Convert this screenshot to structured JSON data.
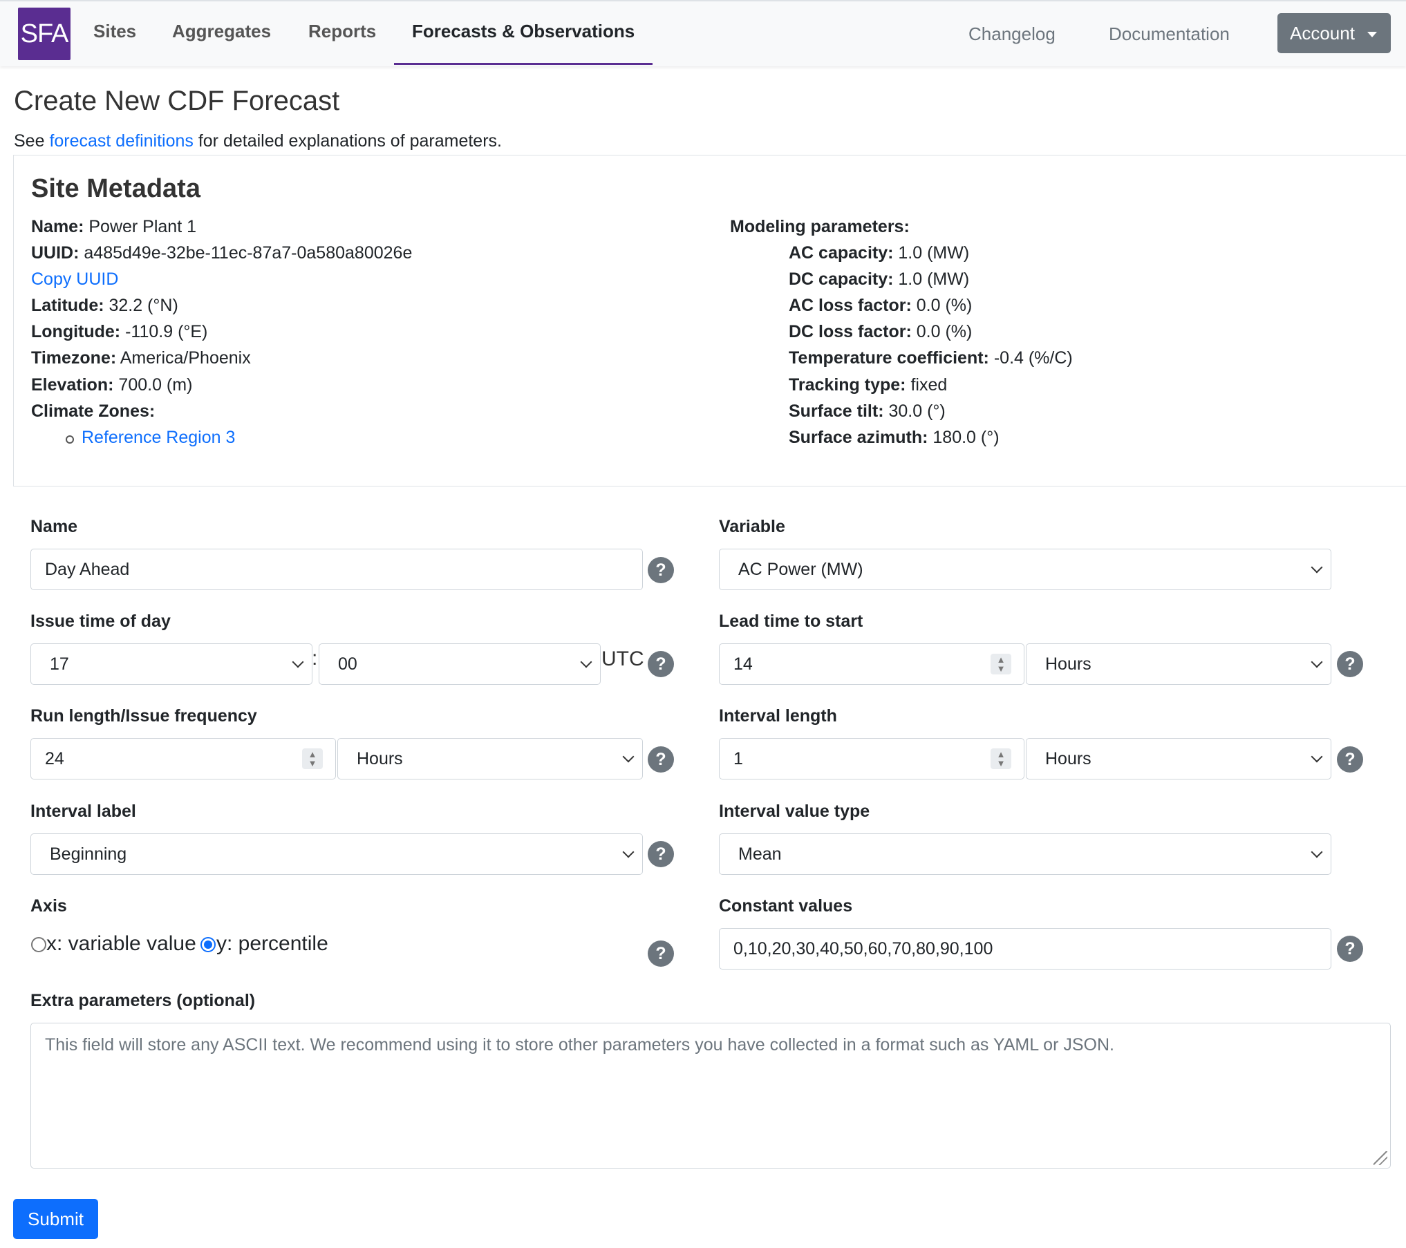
{
  "nav": {
    "logo": "SFA",
    "links": [
      "Sites",
      "Aggregates",
      "Reports",
      "Forecasts & Observations"
    ],
    "right_links": [
      "Changelog",
      "Documentation"
    ],
    "account_label": "Account"
  },
  "page": {
    "title": "Create New CDF Forecast",
    "subtitle_prefix": "See ",
    "subtitle_link": "forecast definitions",
    "subtitle_suffix": " for detailed explanations of parameters."
  },
  "site_metadata": {
    "title": "Site Metadata",
    "left": [
      {
        "label": "Name:",
        "value": " Power Plant 1"
      },
      {
        "label": "UUID:",
        "value": " a485d49e-32be-11ec-87a7-0a580a80026e"
      },
      {
        "label": "",
        "value": ""
      },
      {
        "label": "Latitude:",
        "value": " 32.2 (°N)"
      },
      {
        "label": "Longitude:",
        "value": " -110.9 (°E)"
      },
      {
        "label": "Timezone:",
        "value": " America/Phoenix"
      },
      {
        "label": "Elevation:",
        "value": " 700.0 (m)"
      },
      {
        "label": "Climate Zones:",
        "value": ""
      }
    ],
    "copy_uuid": "Copy UUID",
    "climate_zone_link": "Reference Region 3",
    "modeling_title": "Modeling parameters:",
    "modeling": [
      {
        "label": "AC capacity:",
        "value": " 1.0 (MW)"
      },
      {
        "label": "DC capacity:",
        "value": " 1.0 (MW)"
      },
      {
        "label": "AC loss factor:",
        "value": " 0.0 (%)"
      },
      {
        "label": "DC loss factor:",
        "value": " 0.0 (%)"
      },
      {
        "label": "Temperature coefficient:",
        "value": " -0.4 (%/C)"
      },
      {
        "label": "Tracking type:",
        "value": " fixed"
      },
      {
        "label": "Surface tilt:",
        "value": " 30.0 (°)"
      },
      {
        "label": "Surface azimuth:",
        "value": " 180.0 (°)"
      }
    ]
  },
  "form": {
    "name_label": "Name",
    "name_value": "Day Ahead",
    "variable_label": "Variable",
    "variable_value": "AC Power (MW)",
    "issue_time_label": "Issue time of day",
    "issue_hour": "17",
    "issue_minute": "00",
    "issue_colon": ":",
    "utc": "UTC",
    "lead_time_label": "Lead time to start",
    "lead_time_value": "14",
    "lead_time_unit": "Hours",
    "run_length_label": "Run length/Issue frequency",
    "run_length_value": "24",
    "run_length_unit": "Hours",
    "interval_length_label": "Interval length",
    "interval_length_value": "1",
    "interval_length_unit": "Hours",
    "interval_label_label": "Interval label",
    "interval_label_value": "Beginning",
    "interval_value_type_label": "Interval value type",
    "interval_value_type_value": "Mean",
    "axis_label": "Axis",
    "axis_option_x": "x: variable value",
    "axis_option_y": "y: percentile",
    "constant_values_label": "Constant values",
    "constant_values_value": "0,10,20,30,40,50,60,70,80,90,100",
    "extra_label": "Extra parameters (optional)",
    "extra_placeholder": "This field will store any ASCII text. We recommend using it to store other parameters you have collected in a format such as YAML or JSON.",
    "help_glyph": "?",
    "submit_label": "Submit"
  }
}
